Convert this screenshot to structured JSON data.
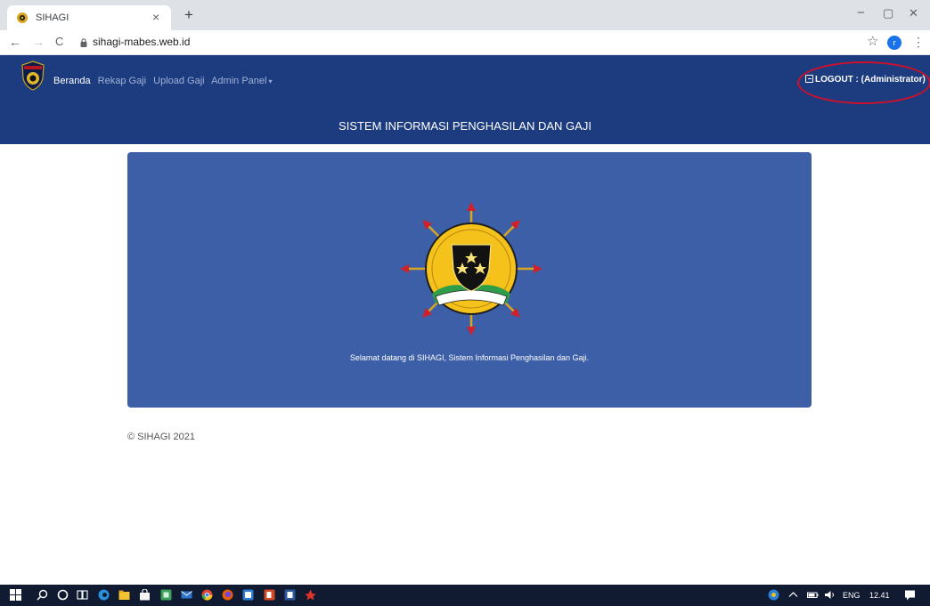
{
  "browser": {
    "tab_title": "SIHAGI",
    "tab_close": "×",
    "new_tab": "+",
    "url": "sihagi-mabes.web.id",
    "nav_back": "←",
    "nav_forward": "→",
    "reload": "C",
    "bookmark_star": "☆",
    "profile_initial": "r",
    "menu": "⋮",
    "window_controls": {
      "minimize": "−",
      "maximize": "▢",
      "close": "✕"
    }
  },
  "navbar": {
    "items": [
      {
        "label": "Beranda",
        "active": true
      },
      {
        "label": "Rekap Gaji",
        "active": false
      },
      {
        "label": "Upload Gaji",
        "active": false
      },
      {
        "label": "Admin Panel",
        "active": false
      }
    ],
    "dropdown_caret": "▾",
    "logout_label": "LOGOUT : (Administrator)",
    "title": "SISTEM INFORMASI PENGHASILAN DAN GAJI"
  },
  "jumbotron": {
    "welcome": "Selamat datang di SIHAGI, Sistem Informasi Penghasilan dan Gaji."
  },
  "footer": {
    "copyright": "© SIHAGI 2021"
  },
  "taskbar": {
    "language": "ENG",
    "time": "12.41"
  },
  "colors": {
    "navbar": "#1d3c80",
    "jumbotron": "#3d5fa8",
    "highlight": "#d0102a",
    "taskbar": "#101a30"
  },
  "icons": {
    "taskbar": [
      "windows-start-icon",
      "search-icon",
      "cortana-icon",
      "task-view-icon",
      "edge-icon",
      "file-explorer-icon",
      "store-icon",
      "spreadsheet-icon",
      "mail-icon",
      "chrome-icon",
      "firefox-icon",
      "app-icon",
      "powerpoint-icon",
      "word-icon",
      "pdf-icon"
    ],
    "tray": [
      "help-icon",
      "chevron-up-icon",
      "battery-icon",
      "volume-icon",
      "notification-icon"
    ]
  }
}
